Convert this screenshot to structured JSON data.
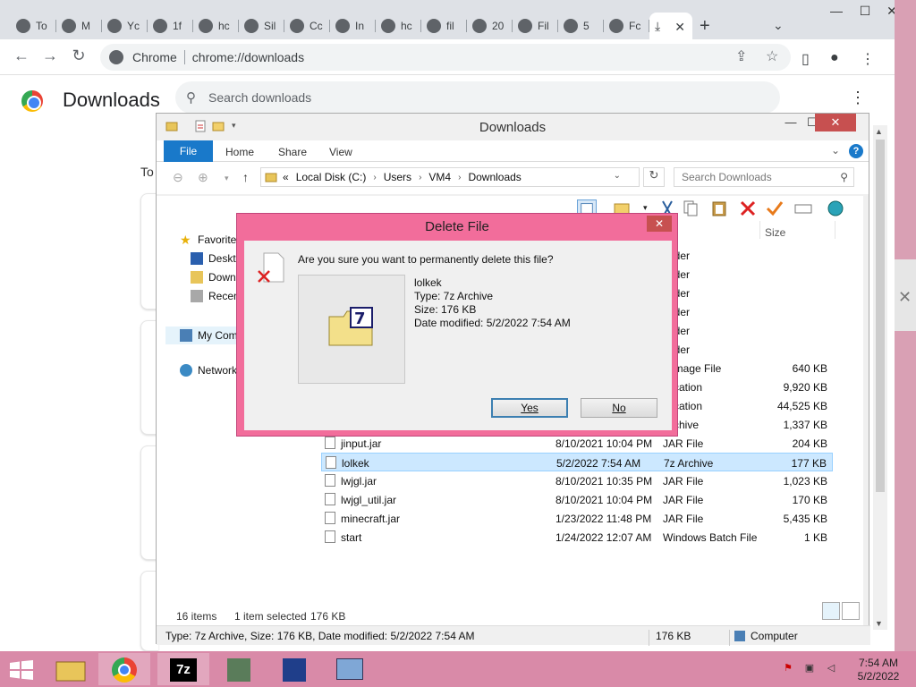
{
  "browser": {
    "tabs": [
      {
        "label": "To"
      },
      {
        "label": "M"
      },
      {
        "label": "Yc"
      },
      {
        "label": "1f"
      },
      {
        "label": "hc"
      },
      {
        "label": "Sil"
      },
      {
        "label": "Cc"
      },
      {
        "label": "In"
      },
      {
        "label": "hc"
      },
      {
        "label": "fil"
      },
      {
        "label": "20"
      },
      {
        "label": "Fil"
      },
      {
        "label": "5"
      },
      {
        "label": "Fc"
      }
    ],
    "active_tab_close": "✕",
    "new_tab": "+",
    "omnibox_site": "Chrome",
    "omnibox_url": "chrome://downloads"
  },
  "downloads_page": {
    "title": "Downloads",
    "search_placeholder": "Search downloads",
    "today_prefix": "To"
  },
  "explorer": {
    "window_title": "Downloads",
    "ribbon": {
      "file": "File",
      "home": "Home",
      "share": "Share",
      "view": "View",
      "help": "?"
    },
    "address": {
      "prefix": "«",
      "crumbs": [
        "Local Disk (C:)",
        "Users",
        "VM4",
        "Downloads"
      ]
    },
    "search_placeholder": "Search Downloads",
    "nav": {
      "favorites": "Favorite",
      "desktop": "Deskto",
      "downloads": "Down",
      "recent": "Recen",
      "computer": "My Com",
      "network": "Network"
    },
    "columns": {
      "size": "Size"
    },
    "files": [
      {
        "name": "",
        "date": "",
        "type": "folder",
        "size": ""
      },
      {
        "name": "",
        "date": "",
        "type": "folder",
        "size": ""
      },
      {
        "name": "",
        "date": "",
        "type": "folder",
        "size": ""
      },
      {
        "name": "",
        "date": "",
        "type": "folder",
        "size": ""
      },
      {
        "name": "",
        "date": "",
        "type": "folder",
        "size": ""
      },
      {
        "name": "",
        "date": "",
        "type": "folder",
        "size": ""
      },
      {
        "name": "",
        "date": "",
        "type": "c Image File",
        "size": "640 KB"
      },
      {
        "name": "",
        "date": "",
        "type": "plication",
        "size": "9,920 KB"
      },
      {
        "name": "",
        "date": "",
        "type": "plication",
        "size": "44,525 KB"
      },
      {
        "name": "",
        "date": "",
        "type": "Archive",
        "size": "1,337 KB"
      },
      {
        "name": "jinput.jar",
        "date": "8/10/2021 10:04 PM",
        "type": "JAR File",
        "size": "204 KB"
      },
      {
        "name": "lolkek",
        "date": "5/2/2022 7:54 AM",
        "type": "7z Archive",
        "size": "177 KB",
        "selected": true
      },
      {
        "name": "lwjgl.jar",
        "date": "8/10/2021 10:35 PM",
        "type": "JAR File",
        "size": "1,023 KB"
      },
      {
        "name": "lwjgl_util.jar",
        "date": "8/10/2021 10:04 PM",
        "type": "JAR File",
        "size": "170 KB"
      },
      {
        "name": "minecraft.jar",
        "date": "1/23/2022 11:48 PM",
        "type": "JAR File",
        "size": "5,435 KB"
      },
      {
        "name": "start",
        "date": "1/24/2022 12:07 AM",
        "type": "Windows Batch File",
        "size": "1 KB"
      }
    ],
    "status": {
      "item_count": "16 items",
      "selection": "1 item selected",
      "selection_size": "176 KB"
    },
    "detail_bar": {
      "summary": "Type: 7z Archive, Size: 176 KB, Date modified: 5/2/2022 7:54 AM",
      "size": "176 KB",
      "location": "Computer"
    }
  },
  "dialog": {
    "title": "Delete File",
    "question": "Are you sure you want to permanently delete this file?",
    "file_name": "lolkek",
    "file_type": "Type: 7z Archive",
    "file_size": "Size: 176 KB",
    "file_date": "Date modified: 5/2/2022 7:54 AM",
    "yes": "Yes",
    "no": "No",
    "close": "✕"
  },
  "taskbar": {
    "time": "7:54 AM",
    "date": "5/2/2022",
    "colors": {
      "accent": "#d98aa8"
    }
  }
}
